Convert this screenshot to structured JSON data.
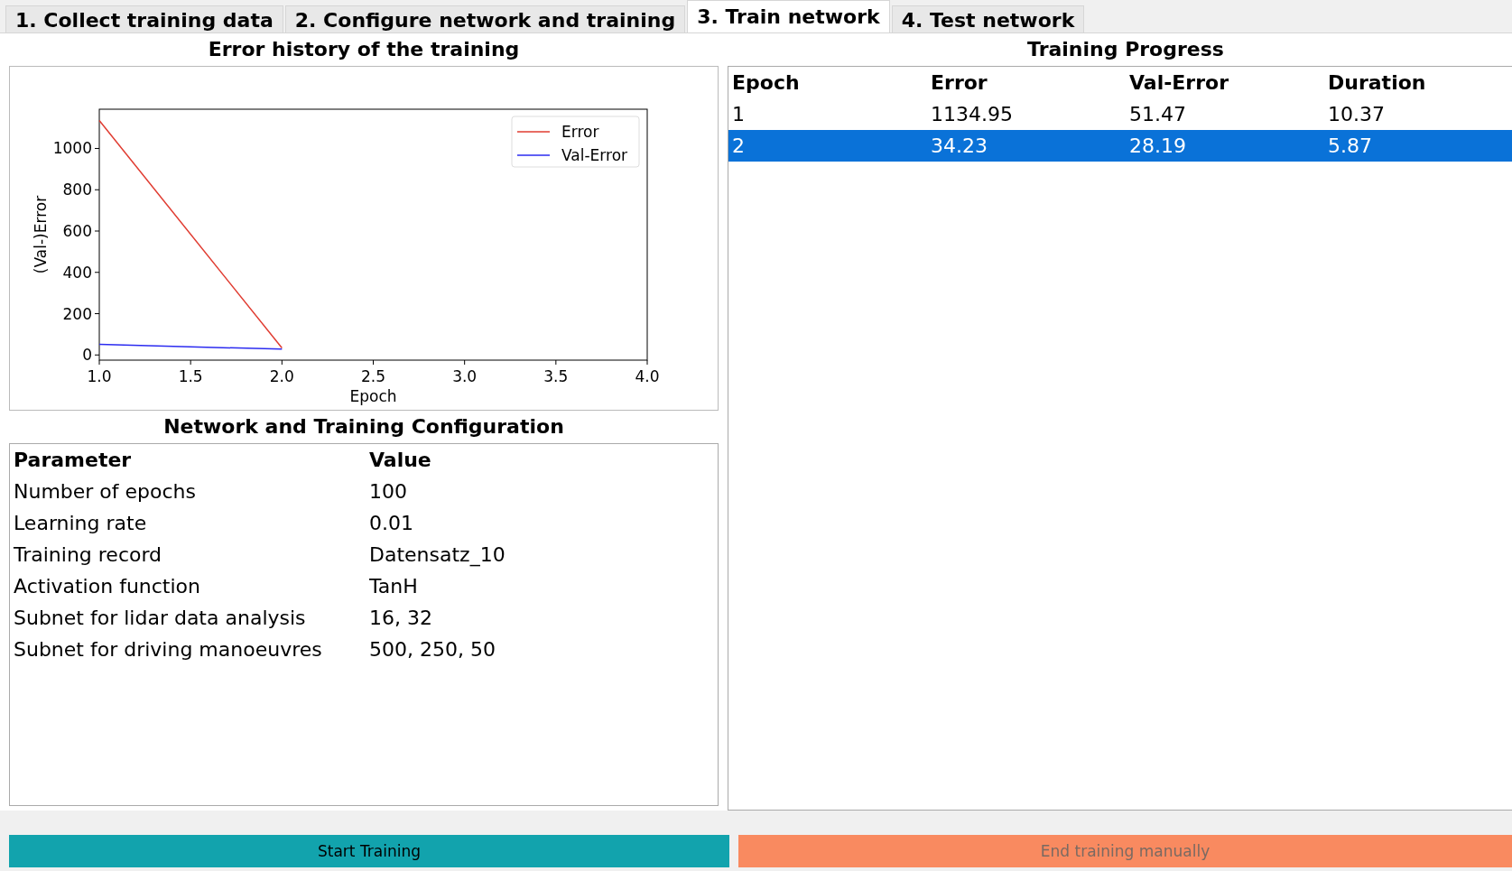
{
  "tabs": [
    {
      "label": "1. Collect training data",
      "selected": false
    },
    {
      "label": "2. Configure network and training",
      "selected": false
    },
    {
      "label": "3. Train network",
      "selected": true
    },
    {
      "label": "4. Test network",
      "selected": false
    }
  ],
  "error_history": {
    "title": "Error history of the training",
    "chart_data": {
      "type": "line",
      "xlabel": "Epoch",
      "ylabel": "(Val-)Error",
      "x": [
        1,
        2
      ],
      "series": [
        {
          "name": "Error",
          "color": "#e03c31",
          "values": [
            1135,
            34
          ]
        },
        {
          "name": "Val-Error",
          "color": "#2b2bf0",
          "values": [
            51,
            28
          ]
        }
      ],
      "legend": true,
      "xlim": [
        1,
        4
      ],
      "ylim": [
        -25,
        1190
      ],
      "xticks": [
        {
          "value": 1,
          "label": "1.0"
        },
        {
          "value": 1.5,
          "label": "1.5"
        },
        {
          "value": 2,
          "label": "2.0"
        },
        {
          "value": 2.5,
          "label": "2.5"
        },
        {
          "value": 3,
          "label": "3.0"
        },
        {
          "value": 3.5,
          "label": "3.5"
        },
        {
          "value": 4,
          "label": "4.0"
        }
      ],
      "yticks": [
        0,
        200,
        400,
        600,
        800,
        1000
      ]
    }
  },
  "configuration": {
    "title": "Network and Training Configuration",
    "columns": [
      "Parameter",
      "Value"
    ],
    "rows": [
      [
        "Number of epochs",
        "100"
      ],
      [
        "Learning rate",
        "0.01"
      ],
      [
        "Training record",
        "Datensatz_10"
      ],
      [
        "Activation function",
        "TanH"
      ],
      [
        "Subnet for lidar data analysis",
        "16, 32"
      ],
      [
        "Subnet for driving manoeuvres",
        "500, 250, 50"
      ]
    ]
  },
  "training_progress": {
    "title": "Training Progress",
    "columns": [
      "Epoch",
      "Error",
      "Val-Error",
      "Duration"
    ],
    "rows": [
      {
        "cells": [
          "1",
          "1134.95",
          "51.47",
          "10.37"
        ],
        "selected": false
      },
      {
        "cells": [
          "2",
          "34.23",
          "28.19",
          "5.87"
        ],
        "selected": true
      }
    ]
  },
  "buttons": [
    {
      "label": "Start Training",
      "color": "#12a3ad",
      "disabled": false
    },
    {
      "label": "End training manually",
      "color": "#f98a60",
      "disabled": true
    }
  ]
}
